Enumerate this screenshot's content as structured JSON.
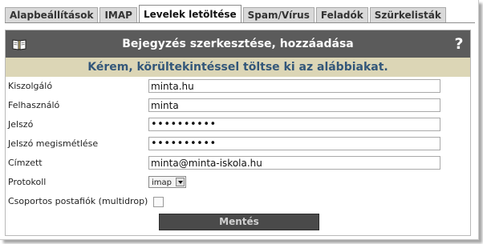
{
  "tabs": [
    {
      "label": "Alapbeállítások",
      "active": false
    },
    {
      "label": "IMAP",
      "active": false
    },
    {
      "label": "Levelek letöltése",
      "active": true
    },
    {
      "label": "Spam/Vírus",
      "active": false
    },
    {
      "label": "Feladók",
      "active": false
    },
    {
      "label": "Szürkelisták",
      "active": false
    }
  ],
  "panel": {
    "title": "Bejegyzés szerkesztése, hozzáadása",
    "help_glyph": "?",
    "notice": "Kérem, körültekintéssel töltse ki az alábbiakat."
  },
  "form": {
    "server_label": "Kiszolgáló",
    "server_value": "minta.hu",
    "user_label": "Felhasználó",
    "user_value": "minta",
    "password_label": "Jelszó",
    "password_value": "••••••••••",
    "password_repeat_label": "Jelszó megismétlése",
    "password_repeat_value": "••••••••••",
    "recipient_label": "Címzett",
    "recipient_value": "minta@minta-iskola.hu",
    "protocol_label": "Protokoll",
    "protocol_value": "imap",
    "multidrop_label": "Csoportos postafiók (multidrop)",
    "multidrop_checked": false,
    "save_label": "Mentés"
  },
  "colors": {
    "header_bg": "#5b5b5b",
    "notice_bg": "#dcd6b6",
    "notice_text": "#33577a",
    "save_bg": "#4a4a4a"
  }
}
